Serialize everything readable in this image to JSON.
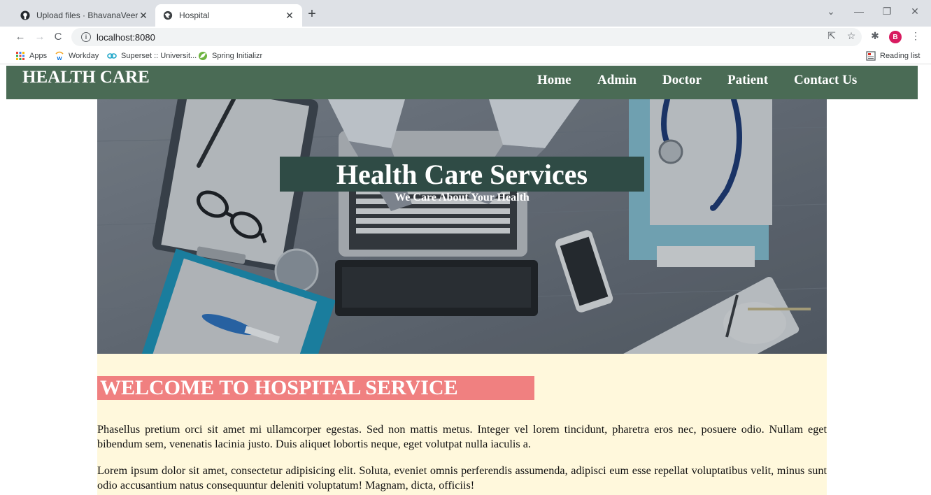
{
  "browser": {
    "tabs": [
      {
        "title": "Upload files · BhavanaVeeranna/",
        "active": false,
        "icon": "github-icon"
      },
      {
        "title": "Hospital",
        "active": true,
        "icon": "globe-icon"
      }
    ],
    "new_tab": "+",
    "window_controls": {
      "dropdown": "⌄",
      "minimize": "—",
      "restore": "❐",
      "close": "✕"
    },
    "nav": {
      "back": "←",
      "forward": "→",
      "reload": "C"
    },
    "url": "localhost:8080",
    "profile_initial": "B",
    "bookmarks": [
      {
        "label": "Apps",
        "icon": "apps-grid-icon"
      },
      {
        "label": "Workday",
        "icon": "workday-icon"
      },
      {
        "label": "Superset :: Universit...",
        "icon": "superset-icon"
      },
      {
        "label": "Spring Initializr",
        "icon": "spring-icon"
      }
    ],
    "reading_list": "Reading list"
  },
  "header": {
    "brand": "HEALTH CARE",
    "nav": [
      "Home",
      "Admin",
      "Doctor",
      "Patient",
      "Contact Us"
    ]
  },
  "hero": {
    "title": "Health Care Services",
    "subtitle": "We Care About Your Health"
  },
  "welcome": {
    "heading": "WELCOME TO HOSPITAL SERVICE",
    "paragraphs": [
      "Phasellus pretium orci sit amet mi ullamcorper egestas. Sed non mattis metus. Integer vel lorem tincidunt, pharetra eros nec, posuere odio. Nullam eget bibendum sem, venenatis lacinia justo. Duis aliquet lobortis neque, eget volutpat nulla iaculis a.",
      "Lorem ipsum dolor sit amet, consectetur adipisicing elit. Soluta, eveniet omnis perferendis assumenda, adipisci eum esse repellat voluptatibus velit, minus sunt odio accusantium natus consequuntur deleniti voluptatum! Magnam, dicta, officiis!"
    ]
  },
  "colors": {
    "header_bg": "#4a6b55",
    "hero_title_bg": "#2f4b45",
    "welcome_heading_bg": "#f08080",
    "welcome_section_bg": "#fff8dc"
  }
}
